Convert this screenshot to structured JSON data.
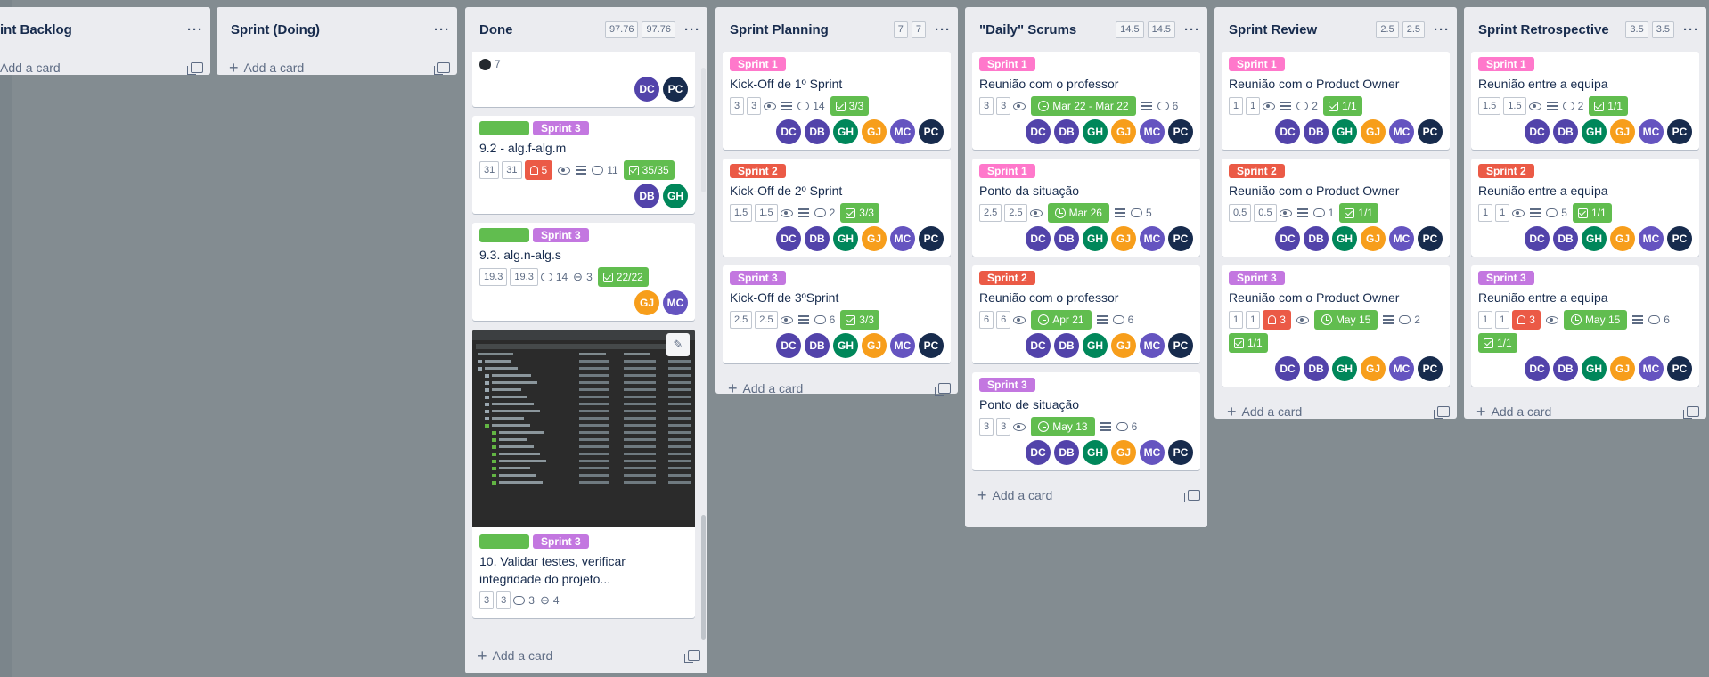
{
  "lists": [
    {
      "title": "int Backlog",
      "add": "Add a card"
    },
    {
      "title": "Sprint (Doing)",
      "add": "Add a card"
    },
    {
      "title": "Done",
      "p1": "97.76",
      "p2": "97.76",
      "add": "Add a card",
      "cards": [
        {
          "gh": "7",
          "members": [
            "DC",
            "PC"
          ]
        },
        {
          "label": "Sprint 3",
          "title": "9.2 - alg.f-alg.m",
          "p1": "31",
          "p2": "31",
          "bell": "5",
          "comments": "11",
          "check": "35/35",
          "members": [
            "DB",
            "GH"
          ]
        },
        {
          "label": "Sprint 3",
          "title": "9.3. alg.n-alg.s",
          "p1": "19.3",
          "p2": "19.3",
          "comments": "14",
          "attach": "3",
          "check": "22/22",
          "members": [
            "GJ",
            "MC"
          ]
        },
        {
          "label": "Sprint 3",
          "title": "10. Validar testes, verificar integridade do projeto...",
          "p1": "3",
          "p2": "3",
          "comments": "3",
          "attach": "4"
        }
      ]
    },
    {
      "title": "Sprint Planning",
      "p1": "7",
      "p2": "7",
      "add": "Add a card",
      "cards": [
        {
          "label": "Sprint 1",
          "title": "Kick-Off de 1º Sprint",
          "p1": "3",
          "p2": "3",
          "comments": "14",
          "check": "3/3"
        },
        {
          "label": "Sprint 2",
          "title": "Kick-Off de 2º Sprint",
          "p1": "1.5",
          "p2": "1.5",
          "comments": "2",
          "check": "3/3"
        },
        {
          "label": "Sprint 3",
          "title": "Kick-Off de 3ºSprint",
          "p1": "2.5",
          "p2": "2.5",
          "comments": "6",
          "check": "3/3"
        }
      ]
    },
    {
      "title": "\"Daily\" Scrums",
      "p1": "14.5",
      "p2": "14.5",
      "add": "Add a card",
      "cards": [
        {
          "label": "Sprint 1",
          "title": "Reunião com o professor",
          "p1": "3",
          "p2": "3",
          "due": "Mar 22 - Mar 22",
          "comments": "6"
        },
        {
          "label": "Sprint 1",
          "title": "Ponto da situação",
          "p1": "2.5",
          "p2": "2.5",
          "due": "Mar 26",
          "comments": "5"
        },
        {
          "label": "Sprint 2",
          "title": "Reunião com o professor",
          "p1": "6",
          "p2": "6",
          "due": "Apr 21",
          "comments": "6"
        },
        {
          "label": "Sprint 3",
          "title": "Ponto de situação",
          "p1": "3",
          "p2": "3",
          "due": "May 13",
          "comments": "6"
        }
      ]
    },
    {
      "title": "Sprint Review",
      "p1": "2.5",
      "p2": "2.5",
      "add": "Add a card",
      "cards": [
        {
          "label": "Sprint 1",
          "title": "Reunião com o Product Owner",
          "p1": "1",
          "p2": "1",
          "comments": "2",
          "check": "1/1"
        },
        {
          "label": "Sprint 2",
          "title": "Reunião com o Product Owner",
          "p1": "0.5",
          "p2": "0.5",
          "comments": "1",
          "check": "1/1"
        },
        {
          "label": "Sprint 3",
          "title": "Reunião com o Product Owner",
          "p1": "1",
          "p2": "1",
          "bell": "3",
          "due": "May 15",
          "comments": "2",
          "check": "1/1"
        }
      ]
    },
    {
      "title": "Sprint Retrospective",
      "p1": "3.5",
      "p2": "3.5",
      "add": "Add a card",
      "cards": [
        {
          "label": "Sprint 1",
          "title": "Reunião entre a equipa",
          "p1": "1.5",
          "p2": "1.5",
          "comments": "2",
          "check": "1/1"
        },
        {
          "label": "Sprint 2",
          "title": "Reunião entre a equipa",
          "p1": "1",
          "p2": "1",
          "comments": "5",
          "check": "1/1"
        },
        {
          "label": "Sprint 3",
          "title": "Reunião entre a equipa",
          "p1": "1",
          "p2": "1",
          "bell": "3",
          "due": "May 15",
          "comments": "6",
          "check": "1/1"
        }
      ]
    }
  ],
  "all_members": [
    "DC",
    "DB",
    "GH",
    "GJ",
    "MC",
    "PC"
  ],
  "menu_glyph": "···",
  "plus_glyph": "+",
  "edit_glyph": "✎"
}
